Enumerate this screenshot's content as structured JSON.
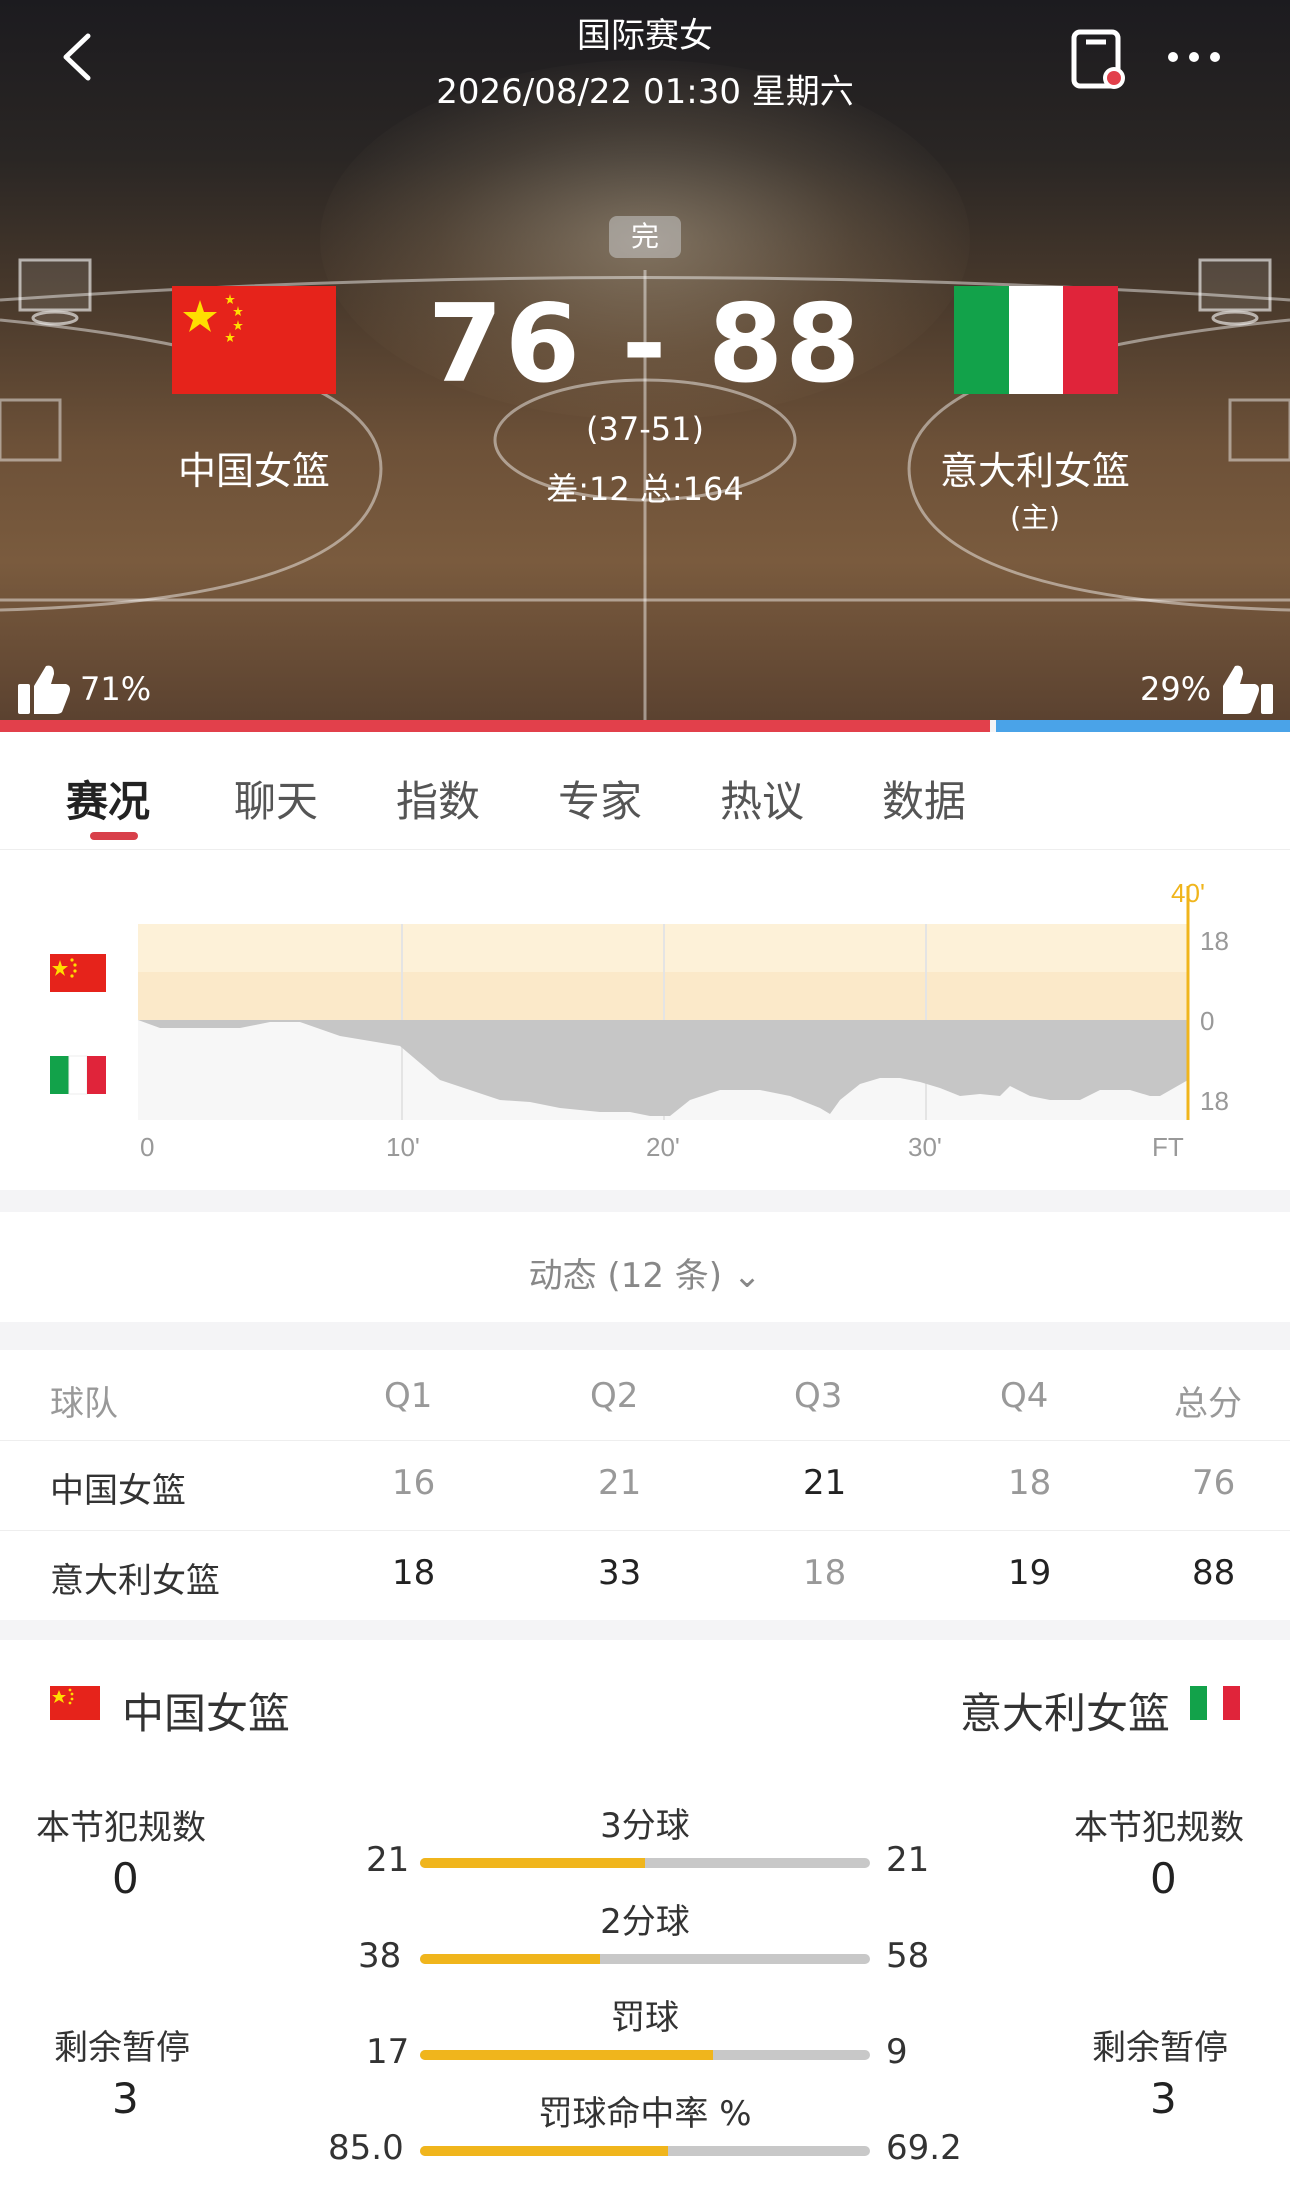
{
  "header": {
    "title": "国际赛女",
    "datetime": "2026/08/22 01:30 星期六",
    "status": "完"
  },
  "match": {
    "home_team": "中国女篮",
    "away_team": "意大利女篮",
    "away_tag": "(主)",
    "score": "76 - 88",
    "halftime": "(37-51)",
    "diff_total": "差:12 总:164",
    "vote_left": "71%",
    "vote_right": "29%",
    "vote_left_value": 0.71,
    "colors": {
      "home": "#e2404b",
      "away": "#4aa3e8"
    }
  },
  "tabs": [
    "赛况",
    "聊天",
    "指数",
    "专家",
    "热议",
    "数据"
  ],
  "trend": {
    "top_label": "40'",
    "y_labels": [
      "18",
      "0",
      "18"
    ],
    "x_labels": [
      "0",
      "10'",
      "20'",
      "30'",
      "FT"
    ]
  },
  "dynamic_label": "动态 (12 条)",
  "quarters": {
    "headers": [
      "球队",
      "Q1",
      "Q2",
      "Q3",
      "Q4",
      "总分"
    ],
    "rows": [
      {
        "team": "中国女篮",
        "q": [
          "16",
          "21",
          "21",
          "18"
        ],
        "total": "76"
      },
      {
        "team": "意大利女篮",
        "q": [
          "18",
          "33",
          "18",
          "19"
        ],
        "total": "88"
      }
    ]
  },
  "stats": {
    "home": "中国女篮",
    "away": "意大利女篮",
    "foul_label": "本节犯规数",
    "foul_home": "0",
    "foul_away": "0",
    "timeout_label": "剩余暂停",
    "timeout_home": "3",
    "timeout_away": "3",
    "items": [
      {
        "label": "3分球",
        "home": "21",
        "away": "21",
        "share": 0.5
      },
      {
        "label": "2分球",
        "home": "38",
        "away": "58",
        "share": 0.4
      },
      {
        "label": "罚球",
        "home": "17",
        "away": "9",
        "share": 0.65
      },
      {
        "label": "罚球命中率 %",
        "home": "85.0",
        "away": "69.2",
        "share": 0.55
      }
    ]
  }
}
